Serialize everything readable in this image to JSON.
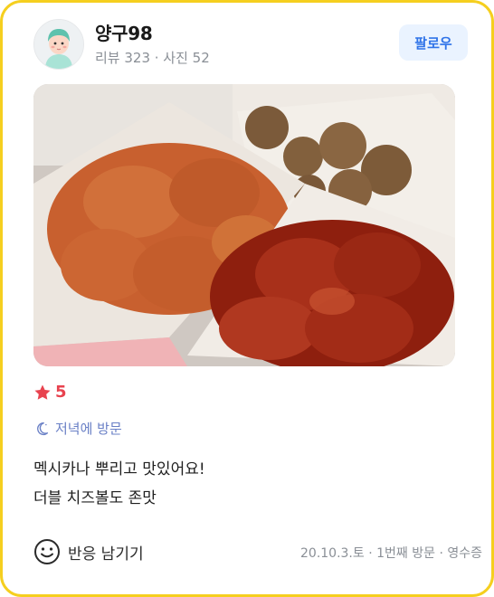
{
  "user": {
    "name": "양구98",
    "stats": "리뷰 323 · 사진 52"
  },
  "follow_button": {
    "label": "팔로우"
  },
  "rating": {
    "value": "5",
    "star_color": "#e8434f"
  },
  "visit": {
    "icon": "moon-icon",
    "label": "저녁에 방문"
  },
  "review": {
    "lines": [
      "멕시카나 뿌리고 맛있어요!",
      "더블 치즈볼도 존맛"
    ]
  },
  "footer": {
    "react_label": "반응 남기기",
    "meta": "20.10.3.토 · 1번째 방문 · 영수증"
  },
  "colors": {
    "card_border": "#f5cf1f",
    "follow_bg": "#eaf3ff",
    "follow_text": "#2f73e8",
    "visit_text": "#6a80c6"
  }
}
